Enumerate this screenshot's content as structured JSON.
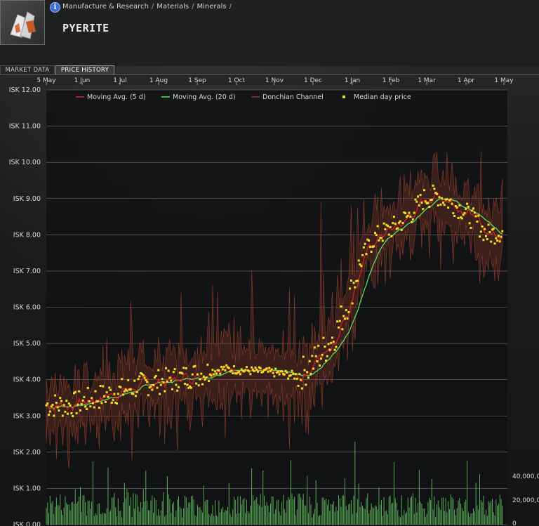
{
  "header": {
    "breadcrumb": [
      "Manufacture & Research",
      "Materials",
      "Minerals"
    ],
    "breadcrumb_trailing_sep": "/",
    "item_name": "PYERITE",
    "info_icon": "i",
    "item_icon": "pyerite-mineral-icon"
  },
  "tabs": [
    {
      "label": "MARKET DATA",
      "active": false
    },
    {
      "label": "PRICE HISTORY",
      "active": true
    }
  ],
  "colors": {
    "ma5": "#e02020",
    "ma20": "#58e058",
    "donchian": "#8a3a2a",
    "median": "#f0e020",
    "volume": "#6fdc6f"
  },
  "chart_data": {
    "type": "line",
    "x_tick_labels": [
      "5 May",
      "1 Jun",
      "1 Jul",
      "1 Aug",
      "1 Sep",
      "1 Oct",
      "1 Nov",
      "1 Dec",
      "1 Jan",
      "1 Feb",
      "1 Mar",
      "1 Apr",
      "1 May"
    ],
    "y_tick_labels": [
      "ISK 12.00",
      "ISK 11.00",
      "ISK 10.00",
      "ISK 9.00",
      "ISK 8.00",
      "ISK 7.00",
      "ISK 6.00",
      "ISK 5.00",
      "ISK 4.00",
      "ISK 3.00",
      "ISK 2.00",
      "ISK 1.00",
      "ISK 0.00"
    ],
    "y2_tick_labels": [
      "40,000,0",
      "20,000,0",
      "0"
    ],
    "ylim": [
      0,
      12
    ],
    "legend": [
      "Moving Avg. (5 d)",
      "Moving Avg. (20 d)",
      "Donchian Channel",
      "Median day price"
    ],
    "legend_position": "top",
    "grid": true,
    "median_anchor_days": [
      0,
      20,
      40,
      60,
      80,
      100,
      120,
      140,
      160,
      180,
      200,
      210,
      220,
      230,
      240,
      250,
      260,
      270,
      280,
      290,
      300,
      310,
      320,
      330,
      340,
      350,
      362
    ],
    "median_anchor_prices": [
      3.3,
      3.3,
      3.5,
      3.7,
      3.9,
      4.0,
      4.15,
      4.3,
      4.25,
      4.2,
      4.1,
      4.4,
      4.8,
      5.3,
      6.2,
      7.3,
      7.9,
      8.1,
      8.3,
      8.6,
      9.0,
      9.1,
      8.9,
      8.7,
      8.4,
      8.0,
      8.1
    ],
    "volume_peak_label": "40,000,0"
  }
}
